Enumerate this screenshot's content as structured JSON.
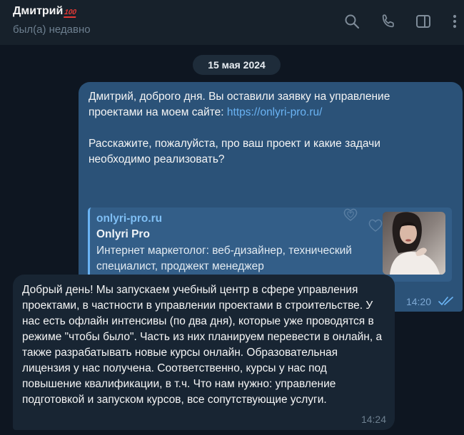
{
  "header": {
    "contact_name": "Дмитрий",
    "contact_badge": "100",
    "status": "был(а) недавно",
    "icons": [
      "search-icon",
      "phone-icon",
      "sidebar-toggle-icon",
      "more-vertical-icon"
    ]
  },
  "chat": {
    "date_label": "15 мая 2024",
    "outgoing": {
      "text_intro": "Дмитрий, доброго дня. Вы оставили заявку на управление проектами на моем сайте: ",
      "link": "https://onlyri-pro.ru/",
      "text_question": "Расскажите, пожалуйста, про ваш проект и какие задачи необходимо реализовать?",
      "preview": {
        "site": "onlyri-pro.ru",
        "title": "Onlyri Pro",
        "description": "Интернет маркетолог: веб-дизайнер, технический специалист, проджект менеджер"
      },
      "time": "14:20",
      "status_icon": "double-check-icon"
    },
    "incoming": {
      "text": "Добрый день! Мы запускаем учебный центр в сфере управления проектами, в частности в управлении проектами в строительстве. У нас есть офлайн интенсивы (по два дня), которые уже проводятся в режиме \"чтобы было\". Часть из них планируем перевести в онлайн, а также разрабатывать новые курсы онлайн. Образовательная лицензия у нас получена. Соответственно, курсы у нас под повышение квалификации, в т.ч. Что нам нужно: управление подготовкой и запуском курсов, все сопутствующие услуги.",
      "time": "14:24"
    }
  },
  "colors": {
    "background": "#0e1621",
    "header": "#17212b",
    "outgoing_bubble": "#2b5278",
    "incoming_bubble": "#182533",
    "link": "#6ab3f3",
    "badge": "#e53935"
  }
}
